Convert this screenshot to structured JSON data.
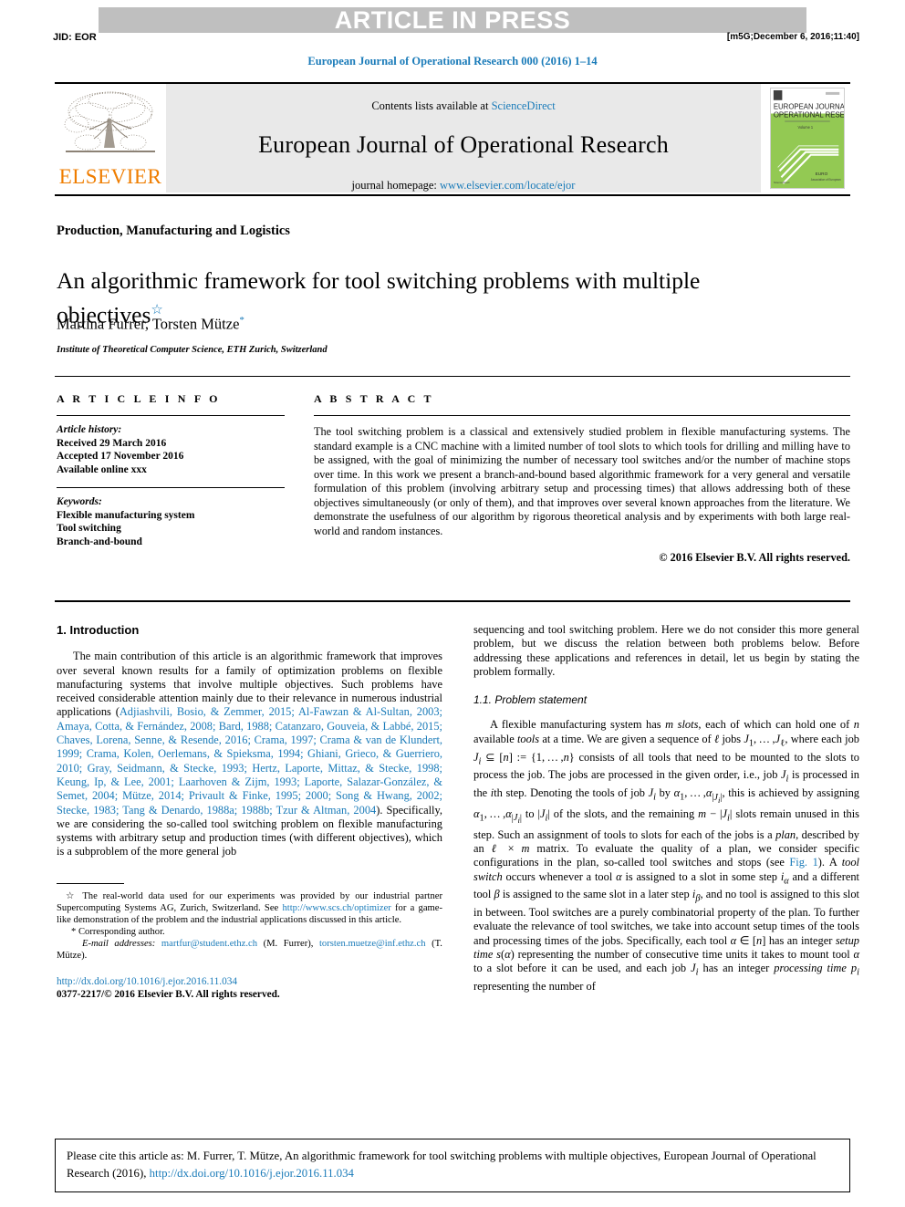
{
  "header": {
    "press_banner": "ARTICLE IN PRESS",
    "jid": "JID: EOR",
    "build_stamp": "[m5G;December 6, 2016;11:40]",
    "journal_ref": "European Journal of Operational Research 000 (2016) 1–14"
  },
  "masthead": {
    "contents_prefix": "Contents lists available at ",
    "contents_link": "ScienceDirect",
    "journal_title": "European Journal of Operational Research",
    "homepage_prefix": "journal homepage: ",
    "homepage_link": "www.elsevier.com/locate/ejor",
    "publisher_wordmark": "ELSEVIER",
    "publisher_logo_icon": "elsevier-tree-icon",
    "cover_line1": "EUROPEAN JOURNAL OF",
    "cover_line2": "OPERATIONAL RESEARCH",
    "cover_volume": "Volume 1"
  },
  "title_block": {
    "section_label": "Production, Manufacturing and Logistics",
    "title": "An algorithmic framework for tool switching problems with multiple objectives",
    "title_footnote_marker": "☆",
    "authors": "Martina Furrer, Torsten Mütze",
    "corresponding_marker": "*",
    "affiliation": "Institute of Theoretical Computer Science, ETH Zurich, Switzerland"
  },
  "article_info": {
    "heading": "A R T I C L E    I N F O",
    "history_label": "Article history:",
    "history": [
      "Received 29 March 2016",
      "Accepted 17 November 2016",
      "Available online xxx"
    ],
    "keywords_label": "Keywords:",
    "keywords": [
      "Flexible manufacturing system",
      "Tool switching",
      "Branch-and-bound"
    ]
  },
  "abstract": {
    "heading": "A B S T R A C T",
    "text": "The tool switching problem is a classical and extensively studied problem in flexible manufacturing systems. The standard example is a CNC machine with a limited number of tool slots to which tools for drilling and milling have to be assigned, with the goal of minimizing the number of necessary tool switches and/or the number of machine stops over time. In this work we present a branch-and-bound based algorithmic framework for a very general and versatile formulation of this problem (involving arbitrary setup and processing times) that allows addressing both of these objectives simultaneously (or only of them), and that improves over several known approaches from the literature. We demonstrate the usefulness of our algorithm by rigorous theoretical analysis and by experiments with both large real-world and random instances.",
    "rights": "© 2016 Elsevier B.V. All rights reserved."
  },
  "body": {
    "intro_heading": "1. Introduction",
    "intro_p1_pre": "The main contribution of this article is an algorithmic framework that improves over several known results for a family of optimization problems on flexible manufacturing systems that involve multiple objectives. Such problems have received considerable attention mainly due to their relevance in numerous industrial applications (",
    "intro_citations": "Adjiashvili, Bosio, & Zemmer, 2015; Al-Fawzan & Al-Sultan, 2003; Amaya, Cotta, & Fernández, 2008; Bard, 1988; Catanzaro, Gouveia, & Labbé, 2015; Chaves, Lorena, Senne, & Resende, 2016; Crama, 1997; Crama & van de Klundert, 1999; Crama, Kolen, Oerlemans, & Spieksma, 1994; Ghiani, Grieco, & Guerriero, 2010; Gray, Seidmann, & Stecke, 1993; Hertz, Laporte, Mittaz, & Stecke, 1998; Keung, Ip, & Lee, 2001; Laarhoven & Zijm, 1993; Laporte, Salazar-González, & Semet, 2004; Mütze, 2014; Privault & Finke, 1995; 2000; Song & Hwang, 2002; Stecke, 1983; Tang & Denardo, 1988a; 1988b; Tzur & Altman, 2004",
    "intro_p1_post": "). Specifically, we are considering the so-called tool switching problem on flexible manufacturing systems with arbitrary setup and production times (with different objectives), which is a subproblem of the more general job",
    "right_p1": "sequencing and tool switching problem. Here we do not consider this more general problem, but we discuss the relation between both problems below. Before addressing these applications and references in detail, let us begin by stating the problem formally.",
    "problem_heading": "1.1. Problem statement",
    "fig_link": "Fig. 1"
  },
  "footnotes": {
    "star_marker": "☆",
    "star_text_pre": "The real-world data used for our experiments was provided by our industrial partner Supercomputing Systems AG, Zurich, Switzerland. See ",
    "star_link": "http://www.scs.ch/optimizer",
    "star_text_post": " for a game-like demonstration of the problem and the industrial applications discussed in this article.",
    "corresponding_marker": "*",
    "corresponding_text": "Corresponding author.",
    "email_label": "E-mail addresses:",
    "email1": "martfur@student.ethz.ch",
    "email1_name": "(M. Furrer),",
    "email2": "torsten.muetze@inf.ethz.ch",
    "email2_name": "(T. Mütze)."
  },
  "doi_block": {
    "doi_url": "http://dx.doi.org/10.1016/j.ejor.2016.11.034",
    "issn_line": "0377-2217/© 2016 Elsevier B.V. All rights reserved."
  },
  "citation_box": {
    "text_pre": "Please cite this article as: M. Furrer, T. Mütze, An algorithmic framework for tool switching problems with multiple objectives, European Journal of Operational Research (2016), ",
    "link": "http://dx.doi.org/10.1016/j.ejor.2016.11.034"
  },
  "colors": {
    "link": "#1a7bb9",
    "banner_gray": "#bfbfbf",
    "masthead_gray": "#e9e9e9",
    "elsevier_orange": "#ef7d00",
    "cover_green": "#8cc63f"
  }
}
